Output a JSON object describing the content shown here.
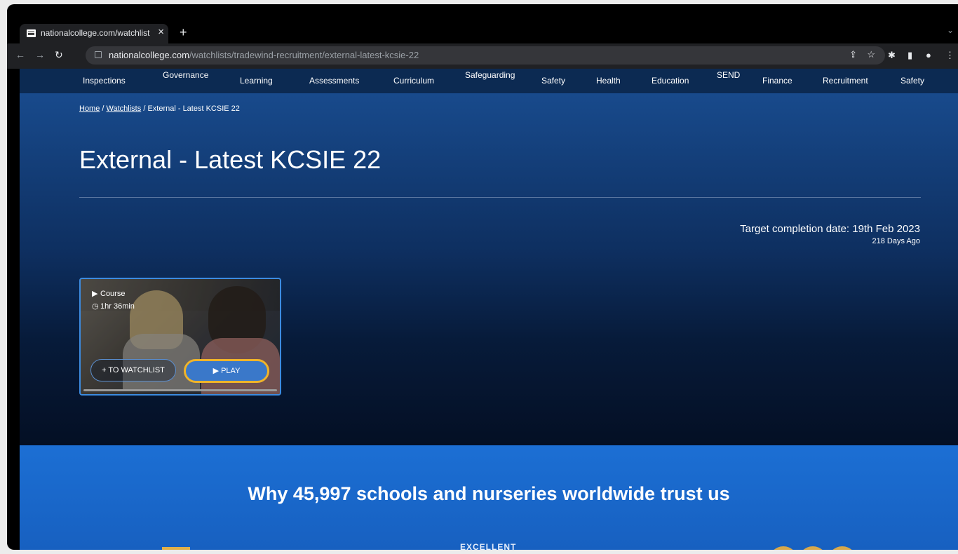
{
  "browser": {
    "tab_title": "nationalcollege.com/watchlist",
    "url_host": "nationalcollege.com",
    "url_path": "/watchlists/tradewind-recruitment/external-latest-kcsie-22"
  },
  "site_nav": {
    "items": [
      "Inspections",
      "Governance",
      "Learning",
      "Assessments",
      "Curriculum",
      "Safeguarding",
      "Safety",
      "Health",
      "Education",
      "SEND",
      "Finance",
      "Recruitment",
      "Safety"
    ]
  },
  "breadcrumbs": {
    "home": "Home",
    "sep1": "/",
    "watchlists": "Watchlists",
    "sep2": "/",
    "current": "External - Latest KCSIE 22"
  },
  "page": {
    "title": "External - Latest KCSIE 22",
    "target_completion": "Target completion date: 19th Feb 2023",
    "days_ago": "218 Days Ago"
  },
  "card": {
    "type": "Course",
    "duration": "1hr 36min",
    "watchlist_label": "TO WATCHLIST",
    "play_label": "PLAY"
  },
  "trust": {
    "heading": "Why 45,997 schools and nurseries worldwide trust us",
    "excellent": "EXCELLENT"
  },
  "colors": {
    "hero_top": "#184a8c",
    "hero_bottom": "#040f24",
    "accent_blue": "#3a78c9",
    "play_border": "#f0b429",
    "trust_bg": "#1c6fd4"
  }
}
